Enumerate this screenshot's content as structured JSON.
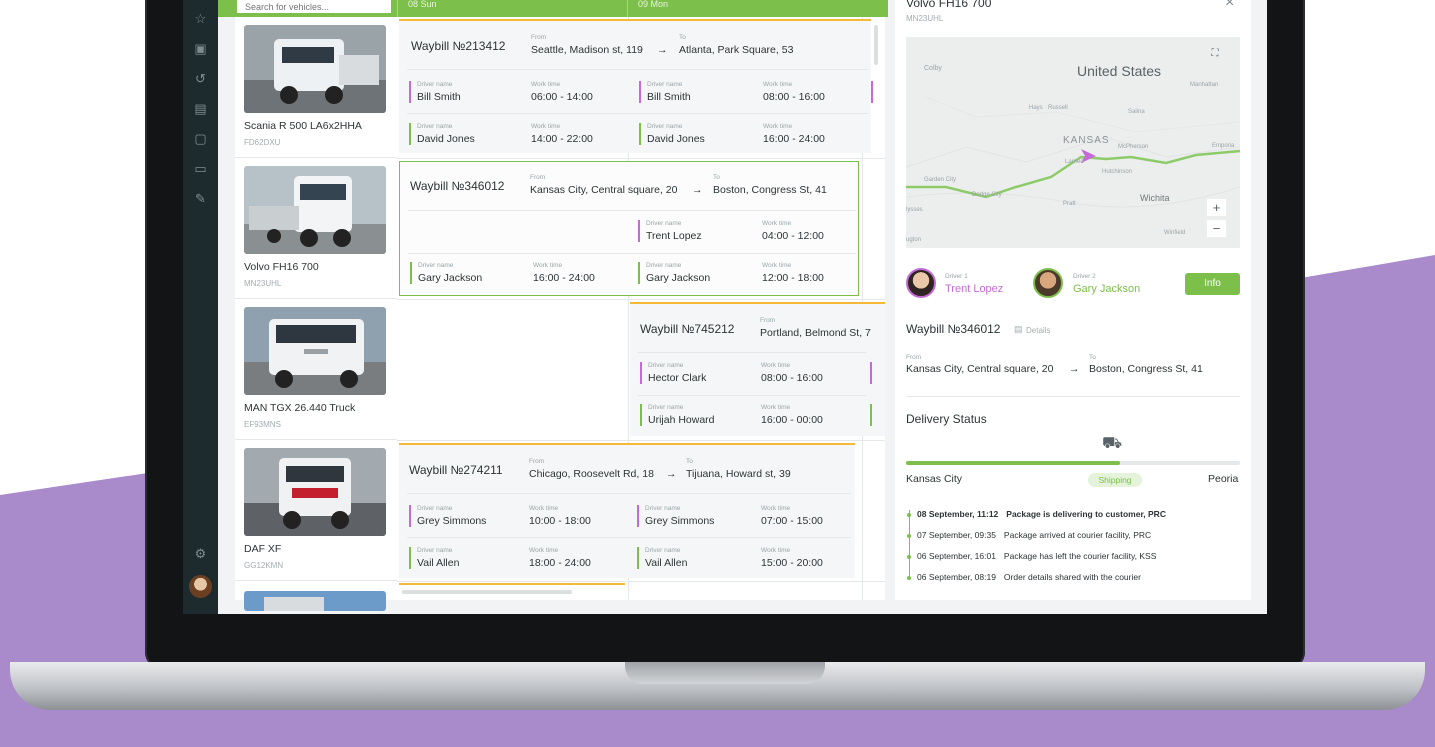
{
  "search": {
    "placeholder": "Search for vehicles..."
  },
  "dates": [
    "08 Sun",
    "09 Mon"
  ],
  "vehicles": [
    {
      "name": "Scania R 500 LA6x2HHA",
      "plate": "FD62DXU"
    },
    {
      "name": "Volvo FH16 700",
      "plate": "MN23UHL"
    },
    {
      "name": "MAN TGX 26.440 Truck",
      "plate": "EF93MNS"
    },
    {
      "name": "DAF XF",
      "plate": "GG12KMN"
    }
  ],
  "labels": {
    "from": "From",
    "to": "To",
    "driver_name": "Driver name",
    "work_time": "Work time",
    "arrow": "→"
  },
  "waybills": [
    {
      "title": "Waybill №213412",
      "from": "Seattle, Madison st, 119",
      "to": "Atlanta, Park Square, 53",
      "rows": [
        {
          "d1": "Bill Smith",
          "t1": "06:00 - 14:00",
          "d2": "Bill Smith",
          "t2": "08:00 - 16:00"
        },
        {
          "d1": "David Jones",
          "t1": "14:00 - 22:00",
          "d2": "David Jones",
          "t2": "16:00 - 24:00"
        }
      ]
    },
    {
      "title": "Waybill №346012",
      "from": "Kansas City, Central square, 20",
      "to": "Boston, Congress St, 41",
      "rows": [
        {
          "d2": "Trent Lopez",
          "t2": "04:00 - 12:00"
        },
        {
          "d1": "Gary Jackson",
          "t1": "16:00 - 24:00",
          "d2": "Gary Jackson",
          "t2": "12:00 - 18:00"
        }
      ]
    },
    {
      "title": "Waybill №745212",
      "from": "Portland, Belmond St, 7",
      "rows": [
        {
          "d2": "Hector Clark",
          "t2": "08:00 - 16:00"
        },
        {
          "d2": "Urijah Howard",
          "t2": "16:00 - 00:00"
        }
      ]
    },
    {
      "title": "Waybill №274211",
      "from": "Chicago, Roosevelt Rd, 18",
      "to": "Tijuana, Howard st, 39",
      "rows": [
        {
          "d1": "Grey Simmons",
          "t1": "10:00 - 18:00",
          "d2": "Grey Simmons",
          "t2": "07:00 - 15:00"
        },
        {
          "d1": "Vail Allen",
          "t1": "18:00 - 24:00",
          "d2": "Vail Allen",
          "t2": "15:00 - 20:00"
        }
      ]
    }
  ],
  "panel": {
    "vehicle_name": "Volvo FH16 700",
    "vehicle_plate": "MN23UHL",
    "close": "×",
    "map_labels": {
      "country": "United States",
      "kansas": "KANSAS",
      "colby": "Colby",
      "manhattan": "Manhattan",
      "hays": "Hays",
      "russell": "Russell",
      "salina": "Salina",
      "mcpherson": "McPherson",
      "larned": "Larned",
      "hutchinson": "Hutchinson",
      "emporia": "Emporia",
      "garden_city": "Garden City",
      "dodge_city": "Dodge City",
      "pratt": "Pratt",
      "wichita": "Wichita",
      "ulysses": "lysses",
      "winfield": "Winfield",
      "liberal": "ugton"
    },
    "zoom_in": "+",
    "zoom_out": "−",
    "driver1_label": "Driver 1",
    "driver1_name": "Trent Lopez",
    "driver2_label": "Driver 2",
    "driver2_name": "Gary Jackson",
    "info_button": "Info",
    "waybill_title": "Waybill №346012",
    "details_link": "Details",
    "from_label": "From",
    "from_value": "Kansas City, Central square, 20",
    "to_label": "To",
    "to_value": "Boston, Congress St, 41",
    "delivery_status_title": "Delivery Status",
    "progress_fraction": 0.64,
    "origin_city": "Kansas City",
    "status_badge": "Shipping",
    "dest_city": "Peoria",
    "timeline": [
      {
        "time": "08 September, 11:12",
        "event": "Package is delivering to customer, PRC",
        "bold": true
      },
      {
        "time": "07 September, 09:35",
        "event": "Package arrived at courier facility, PRC"
      },
      {
        "time": "06 September, 16:01",
        "event": "Package has left the courier facility, KSS"
      },
      {
        "time": "06 September, 08:19",
        "event": "Order details shared with the courier"
      }
    ]
  },
  "colors": {
    "accent_green": "#7dbf4b",
    "driver_purple": "#c46bd9",
    "waybill_orange": "#f4b936",
    "background_purple": "#a98acb"
  }
}
